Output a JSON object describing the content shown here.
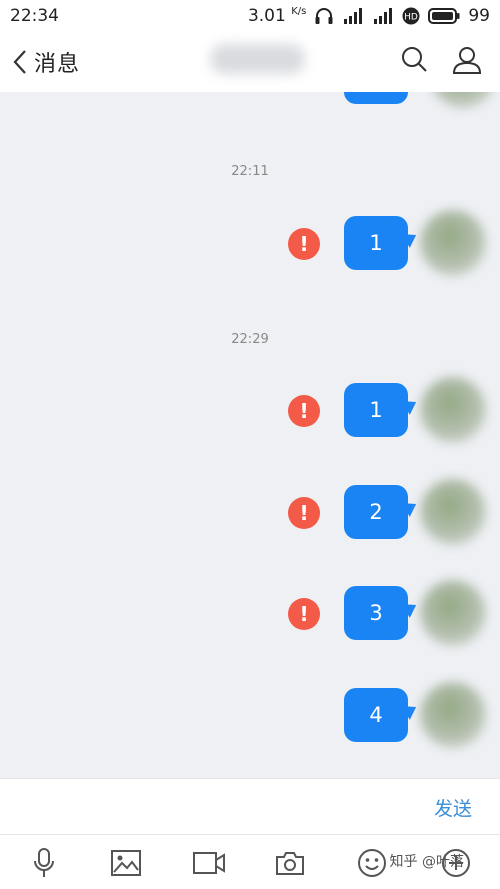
{
  "status_bar": {
    "time": "22:34",
    "speed": "3.01",
    "speed_unit": "K/s",
    "battery": "99"
  },
  "header": {
    "back_label": "消息"
  },
  "timestamps": [
    "22:11",
    "22:29"
  ],
  "messages": [
    {
      "text": "1",
      "failed": true
    },
    {
      "text": "1",
      "failed": true
    },
    {
      "text": "2",
      "failed": true
    },
    {
      "text": "3",
      "failed": true
    },
    {
      "text": "4",
      "failed": false
    }
  ],
  "input": {
    "send_label": "发送"
  },
  "watermark": "知乎 @叶落",
  "colors": {
    "bubble": "#1a84f5",
    "error": "#f35a47",
    "send": "#3b8ed4"
  }
}
